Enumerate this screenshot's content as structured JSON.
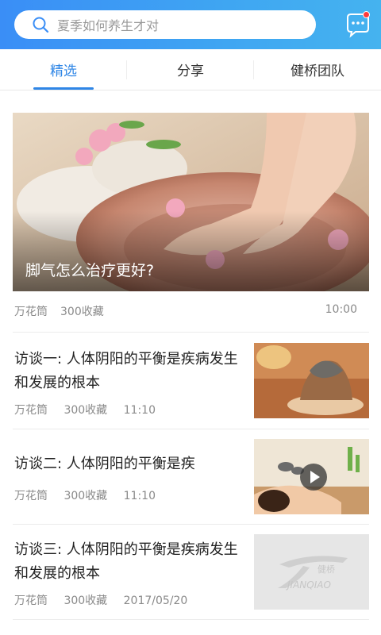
{
  "header": {
    "search_placeholder": "夏季如何养生才对"
  },
  "tabs": [
    {
      "label": "精选",
      "active": true
    },
    {
      "label": "分享",
      "active": false
    },
    {
      "label": "健桥团队",
      "active": false
    }
  ],
  "feature": {
    "title": "脚气怎么治疗更好?",
    "source": "万花筒",
    "favorites": "300收藏",
    "time": "10:00"
  },
  "articles": [
    {
      "title": "访谈一: 人体阴阳的平衡是疾病发生和发展的根本",
      "source": "万花筒",
      "favorites": "300收藏",
      "time": "11:10"
    },
    {
      "title": "访谈二: 人体阴阳的平衡是疾",
      "source": "万花筒",
      "favorites": "300收藏",
      "time": "11:10"
    },
    {
      "title": "访谈三: 人体阴阳的平衡是疾病发生和发展的根本",
      "source": "万花筒",
      "favorites": "300收藏",
      "time": "2017/05/20"
    }
  ],
  "placeholder_logo": {
    "text_cn": "健桥",
    "text_en": "JIANQIAO"
  },
  "colors": {
    "accent": "#2f86e6",
    "header_start": "#3a8ef6",
    "header_end": "#45b3ef",
    "badge": "#ff3b3b"
  }
}
